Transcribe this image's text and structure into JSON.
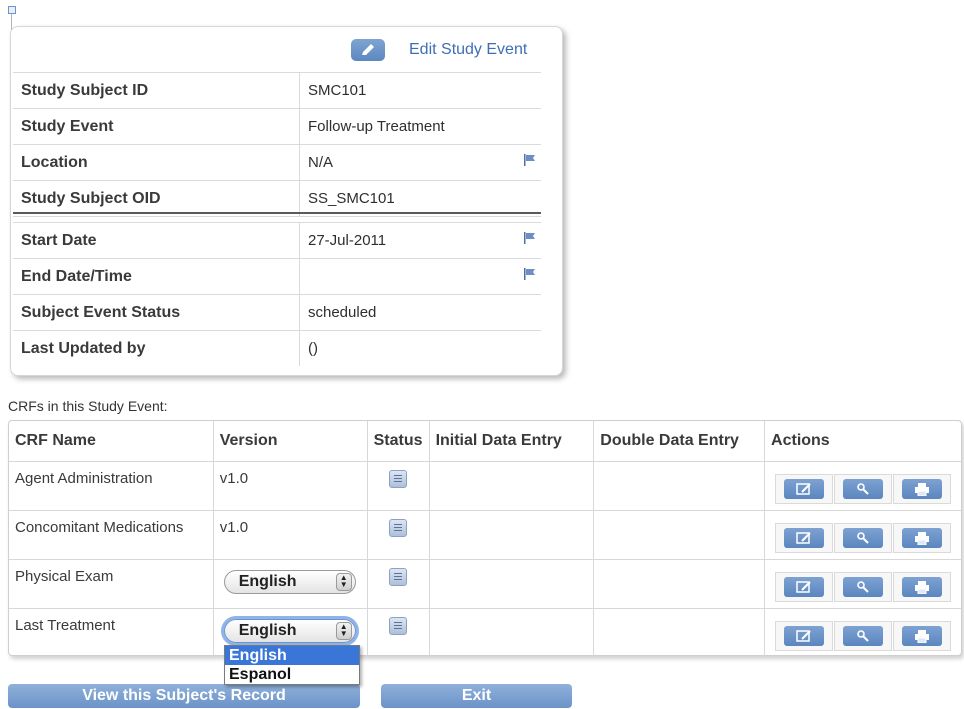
{
  "event_card": {
    "edit_link": "Edit Study Event",
    "rows_top": [
      {
        "label": "Study Subject ID",
        "value": "SMC101",
        "flag": false
      },
      {
        "label": "Study Event",
        "value": "Follow-up Treatment",
        "flag": false
      },
      {
        "label": "Location",
        "value": "N/A",
        "flag": true
      },
      {
        "label": "Study Subject OID",
        "value": "SS_SMC101",
        "flag": false
      }
    ],
    "rows_bottom": [
      {
        "label": "Start Date",
        "value": "27-Jul-2011",
        "flag": true
      },
      {
        "label": "End Date/Time",
        "value": "",
        "flag": true
      },
      {
        "label": "Subject Event Status",
        "value": "scheduled",
        "flag": false
      },
      {
        "label": "Last Updated by",
        "value": "()",
        "flag": false
      }
    ]
  },
  "crfs": {
    "title": "CRFs in this Study Event:",
    "headers": [
      "CRF Name",
      "Version",
      "Status",
      "Initial Data Entry",
      "Double Data Entry",
      "Actions"
    ],
    "rows": [
      {
        "name": "Agent Administration",
        "version": "v1.0"
      },
      {
        "name": "Concomitant Medications",
        "version": "v1.0"
      },
      {
        "name": "Physical Exam",
        "version_select": "English"
      },
      {
        "name": "Last Treatment",
        "version_select": "English"
      }
    ],
    "dropdown_options": [
      "English",
      "Espanol"
    ]
  },
  "buttons": {
    "view_record": "View this Subject's Record",
    "exit": "Exit"
  },
  "colors": {
    "accent": "#5c88c0",
    "link": "#3e6fb4",
    "selected": "#3a76d8"
  }
}
